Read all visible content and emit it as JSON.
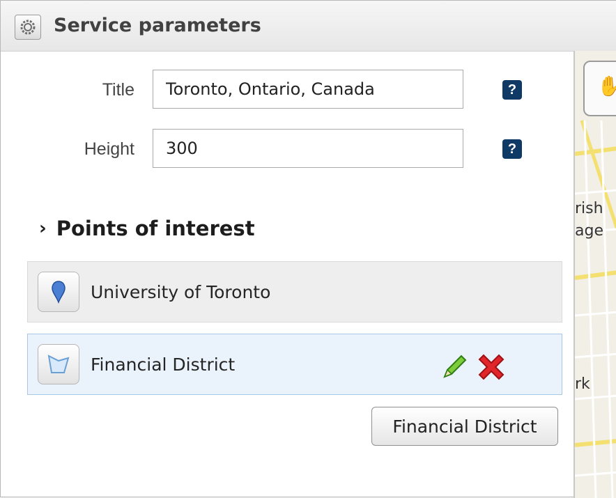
{
  "window": {
    "title": "Service parameters",
    "icon": "gear-icon"
  },
  "form": {
    "title_label": "Title",
    "title_value": "Toronto, Ontario, Canada",
    "height_label": "Height",
    "height_value": "300",
    "help_glyph": "?"
  },
  "poi": {
    "section_title": "Points of interest",
    "items": [
      {
        "label": "University of Toronto",
        "icon": "map-pin-icon"
      },
      {
        "label": "Financial District",
        "icon": "polygon-area-icon"
      }
    ],
    "tooltip": "Financial District"
  },
  "map": {
    "label_1": "rish",
    "label_2": "age",
    "label_3": "rk"
  },
  "colors": {
    "help_bg": "#0f3a66",
    "pin": "#4a7fd4",
    "edit": "#3aa52e",
    "delete": "#e0262b"
  }
}
